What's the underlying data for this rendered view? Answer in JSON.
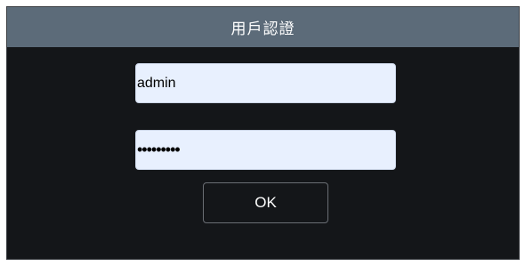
{
  "dialog": {
    "title": "用戶認證"
  },
  "form": {
    "username_value": "admin",
    "password_value": "•••••••••",
    "ok_label": "OK"
  },
  "colors": {
    "titlebar": "#5c6b79",
    "background": "#141619",
    "input_fill": "#e8f0fe",
    "button_border": "#6a6e74"
  }
}
